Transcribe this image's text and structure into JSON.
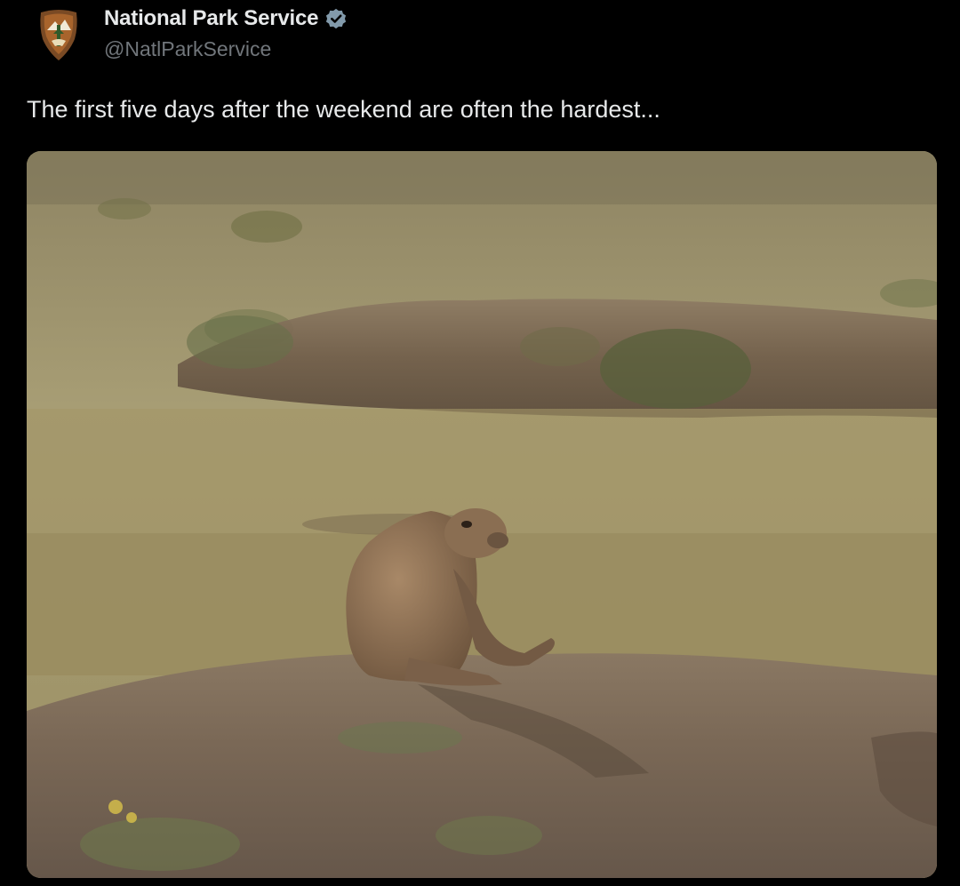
{
  "tweet": {
    "author": {
      "display_name": "National Park Service",
      "handle": "@NatlParkService",
      "verified": true,
      "avatar_icon": "nps-arrowhead-logo-icon",
      "verified_icon": "verified-badge-icon",
      "verified_color": "#829aab"
    },
    "text": "The first five days after the weekend are often the hardest...",
    "media": {
      "type": "photo",
      "subject": "prairie-dog-icon"
    }
  },
  "colors": {
    "background": "#000000",
    "text_primary": "#e7e9ea",
    "text_secondary": "#71767b"
  }
}
